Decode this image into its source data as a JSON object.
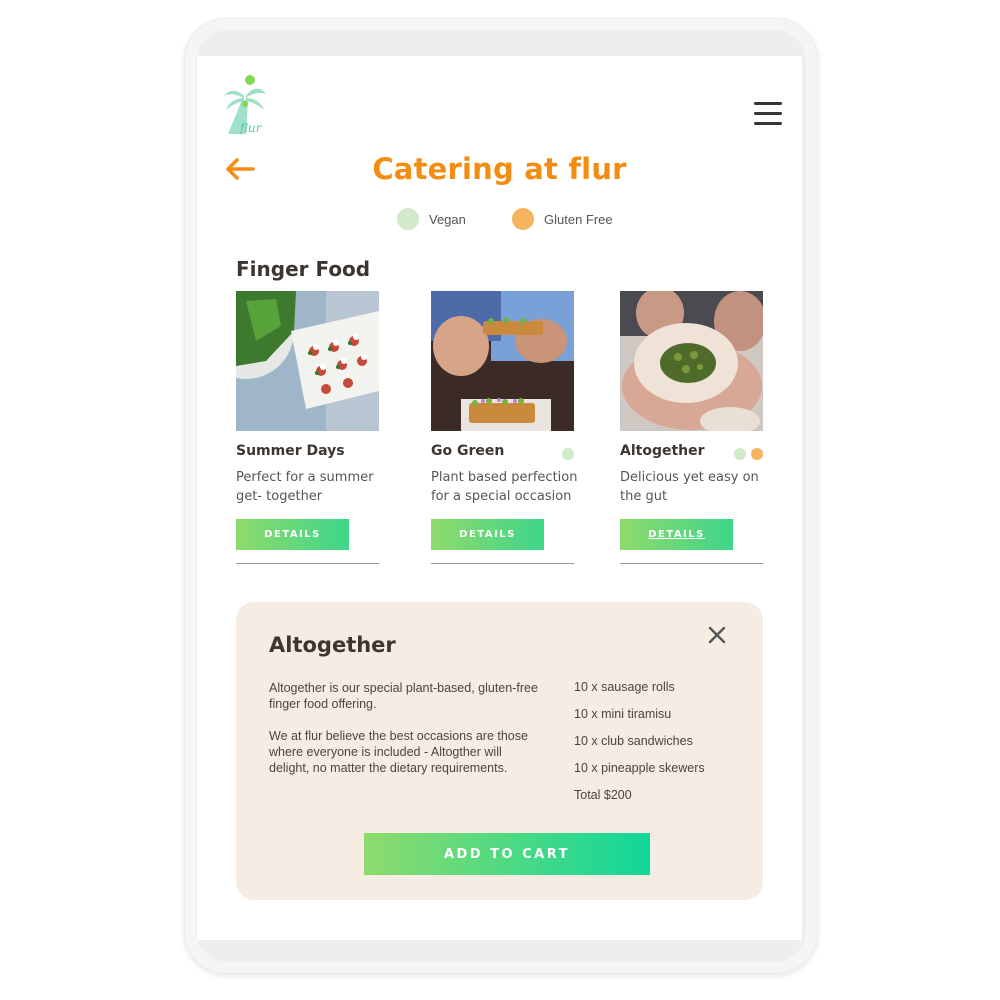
{
  "header": {
    "logo_text": "flur",
    "title": "Catering at flur"
  },
  "legend": [
    {
      "label": "Vegan",
      "color": "#cfe9c9"
    },
    {
      "label": "Gluten Free",
      "color": "#f7b45e"
    }
  ],
  "section": {
    "title": "Finger Food"
  },
  "cards": [
    {
      "name": "Summer Days",
      "description": "Perfect for a summer get- together",
      "button": "DETAILS"
    },
    {
      "name": "Go Green",
      "description": "Plant based perfection for a special occasion",
      "button": "DETAILS"
    },
    {
      "name": "Altogether",
      "description": "Delicious yet easy on the gut",
      "button": "DETAILS"
    }
  ],
  "panel": {
    "title": "Altogether",
    "paragraphs": [
      "Altogether is our special plant-based, gluten-free finger food offering.",
      "We at flur believe the best occasions are those where everyone is included - Altogther will delight, no matter the dietary requirements."
    ],
    "items": [
      "10 x sausage rolls",
      "10 x mini tiramisu",
      "10 x club sandwiches",
      "10 x pineapple skewers"
    ],
    "total": "Total $200",
    "button": "ADD TO CART"
  },
  "colors": {
    "accent": "#f38d12",
    "vegan": "#cfe9c9",
    "gluten_free": "#f7b45e",
    "button_start": "#8edb6b",
    "button_end": "#10d79a",
    "panel_bg": "#f5ede4"
  }
}
